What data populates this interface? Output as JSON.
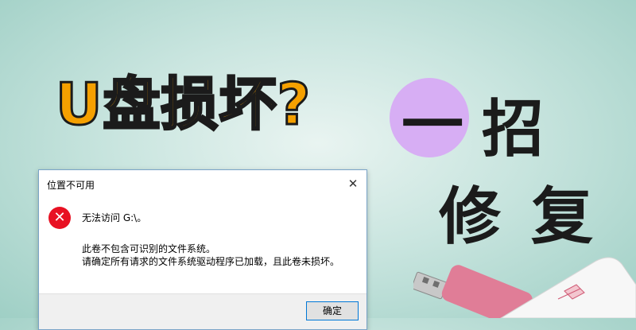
{
  "headline": {
    "text": "U盘损坏?"
  },
  "slogan": {
    "line1_a": "一",
    "line1_b": "招",
    "line2_a": "修",
    "line2_b": "复"
  },
  "dialog": {
    "title": "位置不可用",
    "close_glyph": "✕",
    "error_glyph": "✕",
    "message_primary": "无法访问 G:\\。",
    "message_detail_1": "此卷不包含可识别的文件系统。",
    "message_detail_2": "请确定所有请求的文件系统驱动程序已加载，且此卷未损坏。",
    "ok_label": "确定"
  },
  "colors": {
    "headline_fill": "#f5a000",
    "circle": "#d7aef4",
    "error_red": "#e81123",
    "background": "#c9e5df"
  }
}
